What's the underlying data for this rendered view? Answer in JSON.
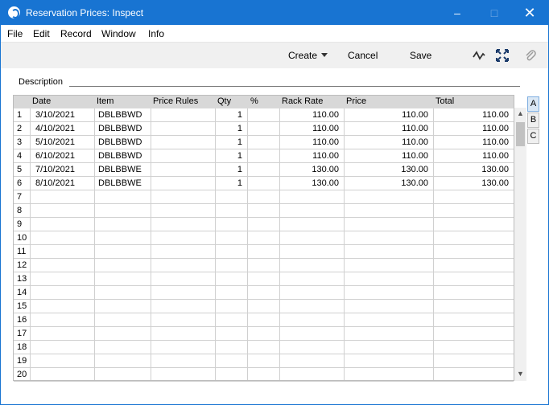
{
  "window": {
    "title": "Reservation Prices: Inspect"
  },
  "menu": [
    "File",
    "Edit",
    "Record",
    "Window",
    "Info"
  ],
  "toolbar": {
    "create_label": "Create",
    "cancel_label": "Cancel",
    "save_label": "Save"
  },
  "form": {
    "description_label": "Description",
    "description_value": ""
  },
  "grid": {
    "headers": [
      "Date",
      "Item",
      "Price Rules",
      "Qty",
      "%",
      "Rack Rate",
      "Price",
      "Total"
    ],
    "rows": [
      {
        "n": "1",
        "date": "3/10/2021",
        "item": "DBLBBWD",
        "rules": "",
        "qty": "1",
        "pct": "",
        "rack": "110.00",
        "price": "110.00",
        "total": "110.00"
      },
      {
        "n": "2",
        "date": "4/10/2021",
        "item": "DBLBBWD",
        "rules": "",
        "qty": "1",
        "pct": "",
        "rack": "110.00",
        "price": "110.00",
        "total": "110.00"
      },
      {
        "n": "3",
        "date": "5/10/2021",
        "item": "DBLBBWD",
        "rules": "",
        "qty": "1",
        "pct": "",
        "rack": "110.00",
        "price": "110.00",
        "total": "110.00"
      },
      {
        "n": "4",
        "date": "6/10/2021",
        "item": "DBLBBWD",
        "rules": "",
        "qty": "1",
        "pct": "",
        "rack": "110.00",
        "price": "110.00",
        "total": "110.00"
      },
      {
        "n": "5",
        "date": "7/10/2021",
        "item": "DBLBBWE",
        "rules": "",
        "qty": "1",
        "pct": "",
        "rack": "130.00",
        "price": "130.00",
        "total": "130.00"
      },
      {
        "n": "6",
        "date": "8/10/2021",
        "item": "DBLBBWE",
        "rules": "",
        "qty": "1",
        "pct": "",
        "rack": "130.00",
        "price": "130.00",
        "total": "130.00"
      },
      {
        "n": "7"
      },
      {
        "n": "8"
      },
      {
        "n": "9"
      },
      {
        "n": "10"
      },
      {
        "n": "11"
      },
      {
        "n": "12"
      },
      {
        "n": "13"
      },
      {
        "n": "14"
      },
      {
        "n": "15"
      },
      {
        "n": "16"
      },
      {
        "n": "17"
      },
      {
        "n": "18"
      },
      {
        "n": "19"
      },
      {
        "n": "20"
      }
    ]
  },
  "tabs": [
    "A",
    "B",
    "C"
  ],
  "icons": {
    "app": "app-icon",
    "minimize": "minimize-icon",
    "maximize": "maximize-icon",
    "close": "close-icon",
    "activity": "activity-icon",
    "fullscreen": "fullscreen-icon",
    "attach": "paperclip-icon"
  }
}
